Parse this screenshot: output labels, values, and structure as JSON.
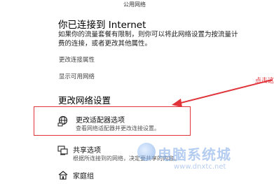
{
  "header": {
    "network_type": "公用网络"
  },
  "status": {
    "title": "你已连接到 Internet",
    "desc_line1": "如果你的流量套餐有限制，则你可以将此网络设置为按流量计",
    "desc_line2": "费的连接，或者更改其他属性。",
    "link_change_properties": "更改连接属性",
    "link_show_networks": "显示可用网络"
  },
  "section": {
    "title": "更改网络设置"
  },
  "items": [
    {
      "title": "更改适配器选项",
      "subtitle": "查看网络适配器并更改连接设置。",
      "icon": "adapter-globe-icon"
    },
    {
      "title": "共享选项",
      "subtitle": "根据所连接到的网络，决定要共享的内容。",
      "icon": "sharing-icon"
    },
    {
      "title": "家庭组",
      "subtitle": "",
      "icon": "homegroup-icon"
    }
  ],
  "annotation": {
    "text": "点击这",
    "color": "#e0343a"
  },
  "watermark": {
    "name": "电脑系统城",
    "url": "www.dnxtc.net"
  }
}
